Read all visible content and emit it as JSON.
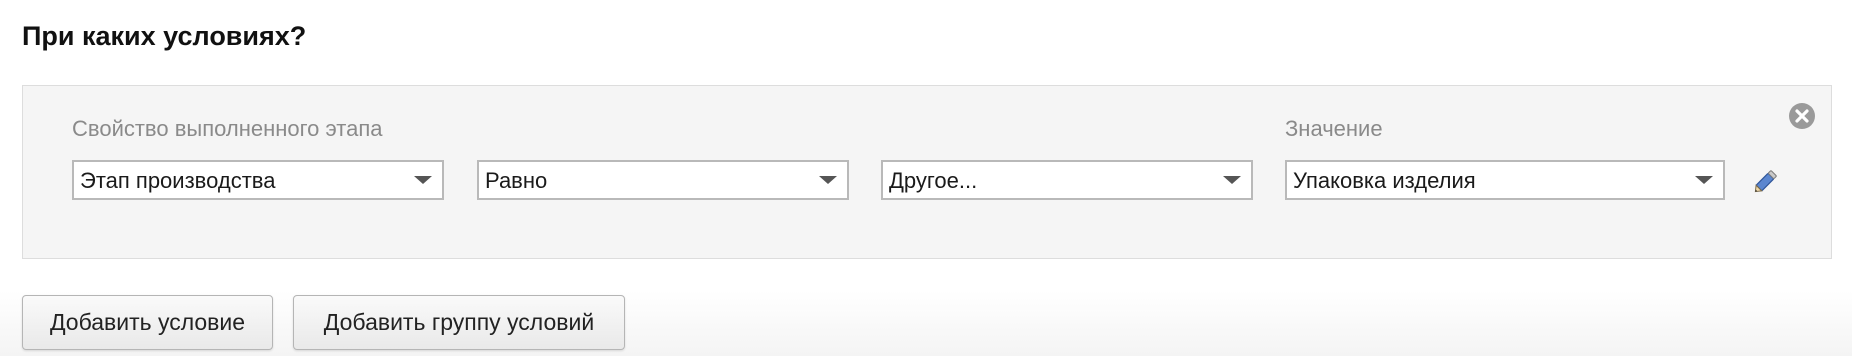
{
  "heading": "При каких условиях?",
  "condition": {
    "property_label": "Свойство выполненного этапа",
    "value_label": "Значение",
    "property_select": {
      "value": "Этап производства"
    },
    "operator_select": {
      "value": "Равно"
    },
    "type_select": {
      "value": "Другое..."
    },
    "value_select": {
      "value": "Упаковка изделия"
    },
    "icons": {
      "edit": "pencil-icon",
      "remove": "close-circle-icon"
    }
  },
  "buttons": {
    "add_condition": "Добавить условие",
    "add_group": "Добавить группу условий"
  },
  "colors": {
    "panel_bg": "#f5f5f5",
    "label_gray": "#8a8a8a",
    "pencil_blue": "#4a78c2",
    "remove_gray": "#9a9a9a"
  }
}
